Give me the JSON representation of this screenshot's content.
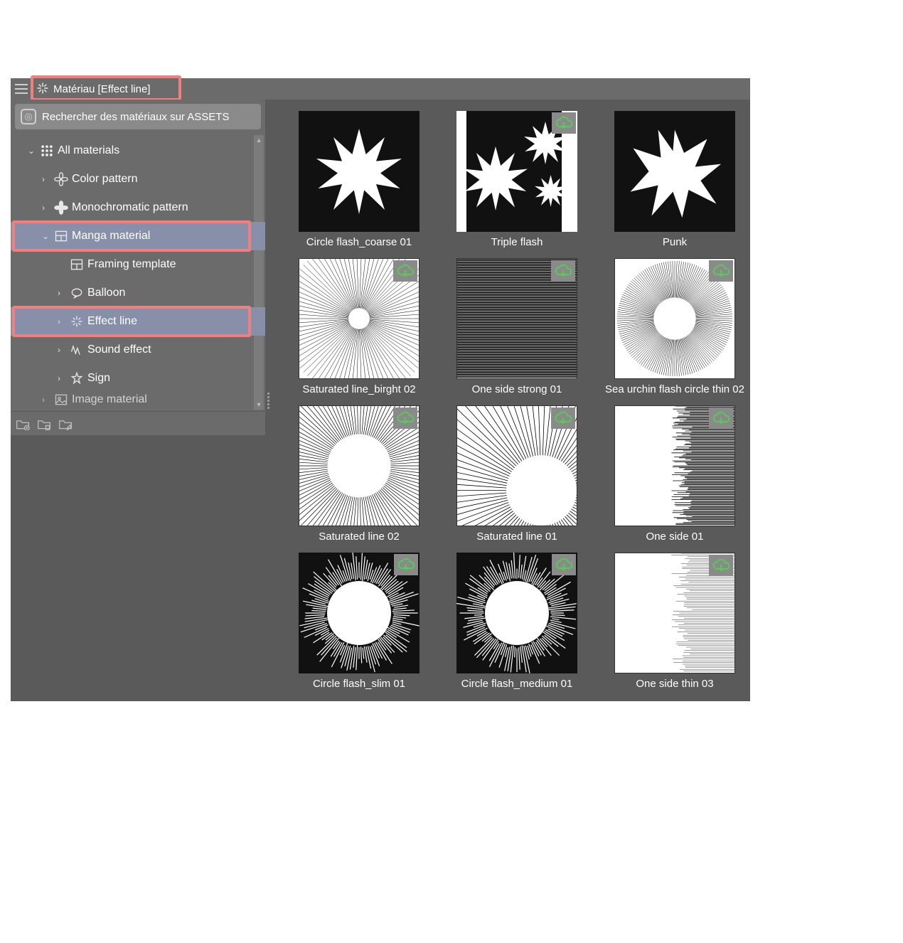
{
  "header": {
    "title": "Matériau [Effect line]"
  },
  "search": {
    "label": "Rechercher des matériaux sur ASSETS"
  },
  "tree": {
    "items": [
      {
        "label": "All materials",
        "indent": 1,
        "chev": "down",
        "icon": "grid"
      },
      {
        "label": "Color pattern",
        "indent": 2,
        "chev": "right",
        "icon": "flower"
      },
      {
        "label": "Monochromatic pattern",
        "indent": 2,
        "chev": "right",
        "icon": "flower-solid"
      },
      {
        "label": "Manga material",
        "indent": 2,
        "chev": "down",
        "icon": "panel",
        "selected": true,
        "highlighted": true
      },
      {
        "label": "Framing template",
        "indent": 3,
        "chev": "",
        "icon": "panel"
      },
      {
        "label": "Balloon",
        "indent": 3,
        "chev": "right",
        "icon": "balloon"
      },
      {
        "label": "Effect line",
        "indent": 3,
        "chev": "right",
        "icon": "sparkle",
        "selected": true,
        "highlighted": true
      },
      {
        "label": "Sound effect",
        "indent": 3,
        "chev": "right",
        "icon": "sound"
      },
      {
        "label": "Sign",
        "indent": 3,
        "chev": "right",
        "icon": "sparkle2"
      },
      {
        "label": "Image material",
        "indent": 2,
        "chev": "right",
        "icon": "image",
        "cut": true
      }
    ]
  },
  "thumbs": [
    {
      "label": "Circle flash_coarse 01",
      "bg": "dark",
      "cloud": false,
      "art": "burst1"
    },
    {
      "label": "Triple flash",
      "bg": "dark",
      "cloud": true,
      "art": "burst3"
    },
    {
      "label": "Punk",
      "bg": "dark",
      "cloud": false,
      "art": "punk"
    },
    {
      "label": "Saturated line_birght 02",
      "bg": "light",
      "cloud": true,
      "art": "radial-thin"
    },
    {
      "label": "One side strong 01",
      "bg": "light",
      "cloud": true,
      "art": "side-strong"
    },
    {
      "label": "Sea urchin flash circle thin 02",
      "bg": "light",
      "cloud": true,
      "art": "urchin"
    },
    {
      "label": "Saturated line 02",
      "bg": "light",
      "cloud": true,
      "art": "radial-hole"
    },
    {
      "label": "Saturated line 01",
      "bg": "light",
      "cloud": true,
      "art": "radial-corner"
    },
    {
      "label": "One side 01",
      "bg": "light",
      "cloud": true,
      "art": "side"
    },
    {
      "label": "Circle flash_slim 01",
      "bg": "dark",
      "cloud": true,
      "art": "fuzzy-burst"
    },
    {
      "label": "Circle flash_medium 01",
      "bg": "dark",
      "cloud": true,
      "art": "fuzzy-burst"
    },
    {
      "label": "One side thin 03",
      "bg": "light",
      "cloud": true,
      "art": "side-thin"
    }
  ]
}
